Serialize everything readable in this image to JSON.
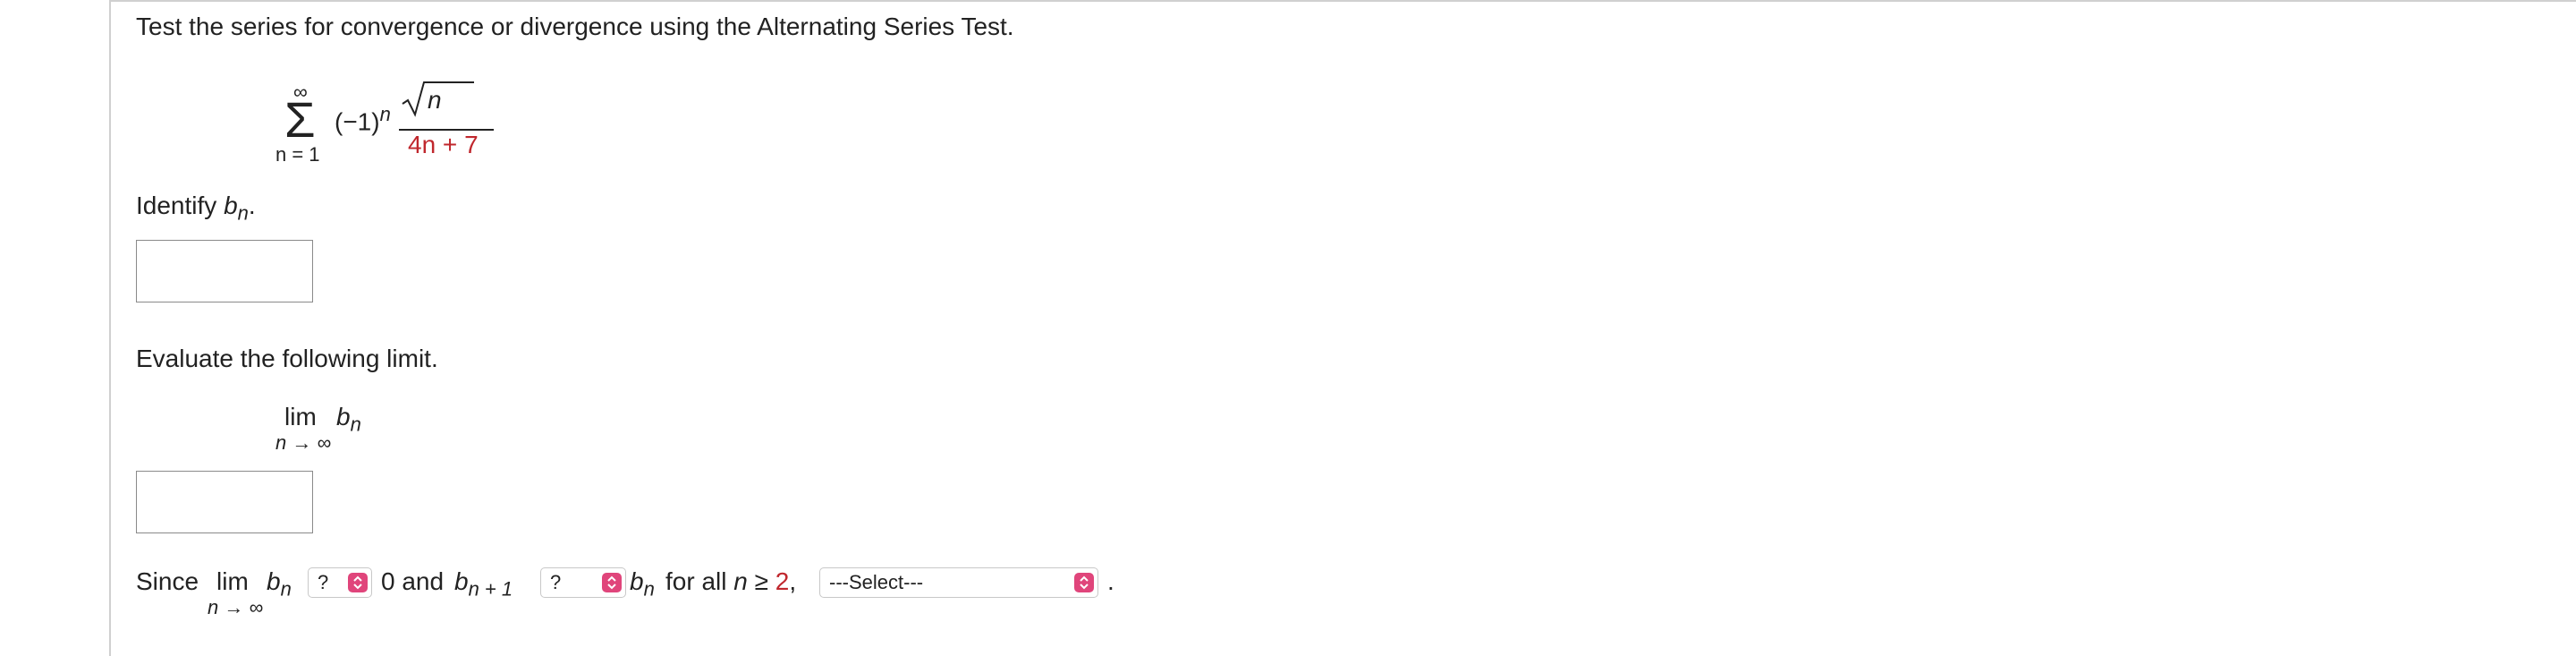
{
  "question": {
    "prompt": "Test the series for convergence or divergence using the Alternating Series Test.",
    "series": {
      "sum_upper": "∞",
      "sum_lower": "n = 1",
      "sign_base": "(−1)",
      "sign_exp": "n",
      "numerator_var": "n",
      "denominator_prefix": "4n + ",
      "denominator_const": "7"
    }
  },
  "identify": {
    "label_prefix": "Identify ",
    "label_var": "b",
    "label_sub": "n",
    "label_suffix": ".",
    "input_value": ""
  },
  "evaluate": {
    "prompt": "Evaluate the following limit.",
    "lim_word": "lim",
    "lim_under": "n → ∞",
    "lim_var": "b",
    "lim_sub": "n",
    "input_value": ""
  },
  "since_line": {
    "since": "Since",
    "lim_word": "lim",
    "lim_under": "n → ∞",
    "b": "b",
    "sub_n": "n",
    "select1_value": "?",
    "zero_and": "0 and",
    "b2": "b",
    "sub_n1": "n + 1",
    "select2_value": "?",
    "b3": "b",
    "sub_n3": "n",
    "for_all": "for all",
    "n_var": "n",
    "geq": "≥",
    "two": "2",
    "comma": ",",
    "select3_value": "---Select---",
    "period": "."
  },
  "colors": {
    "accent_red": "#c0272d",
    "chevron_pink": "#e0457b"
  }
}
